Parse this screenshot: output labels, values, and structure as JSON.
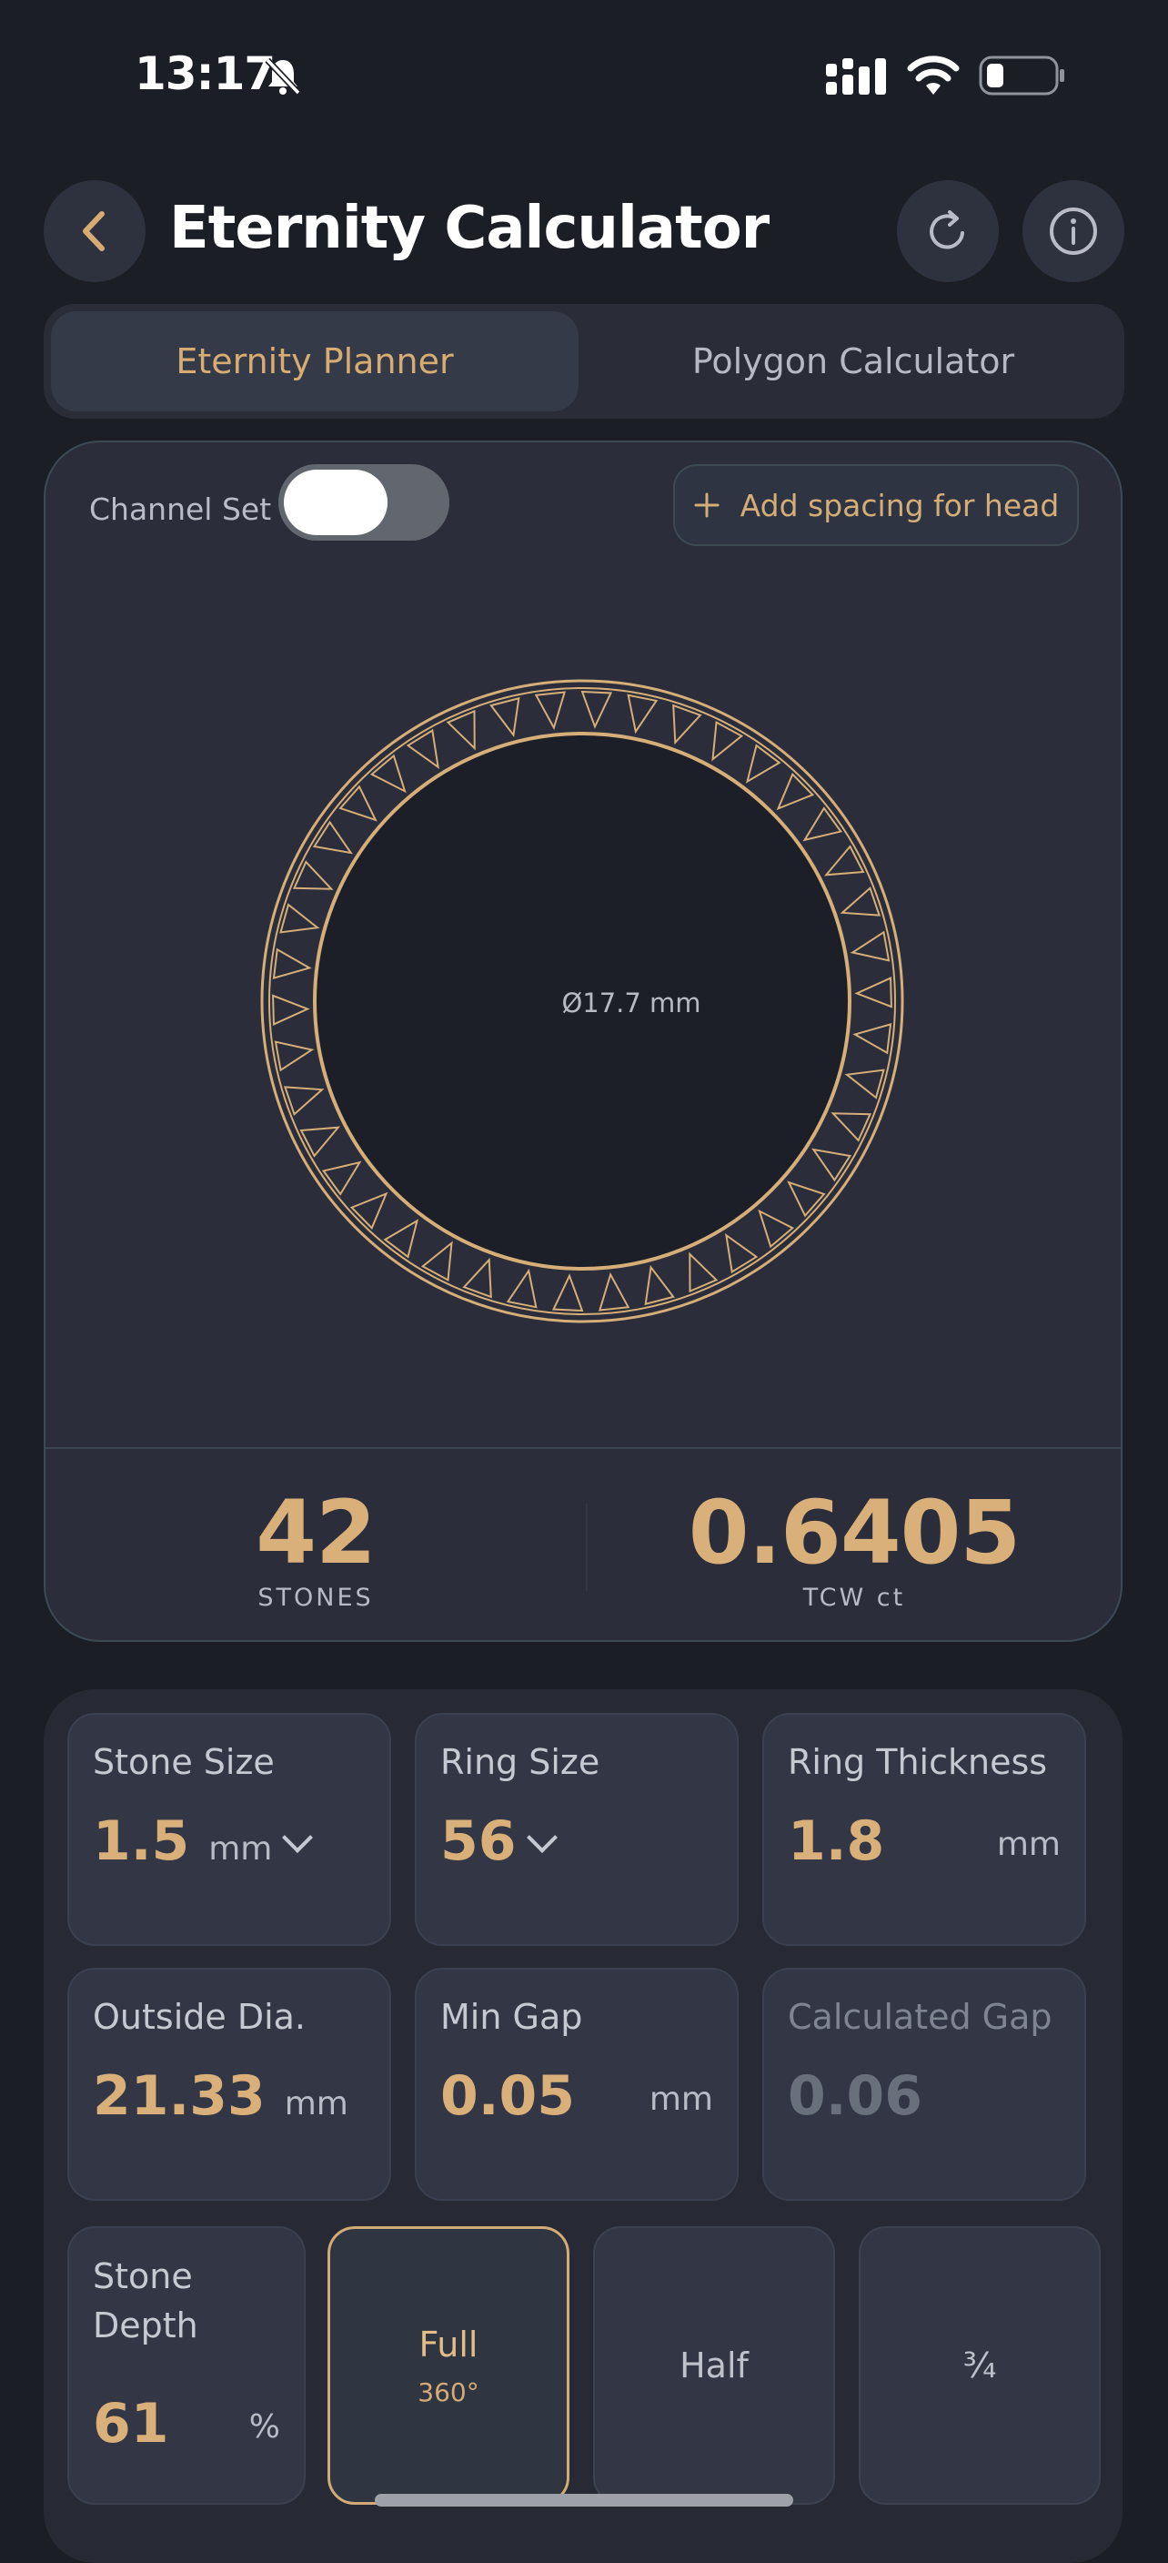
{
  "status_bar": {
    "time": "13:17",
    "icons": [
      "bell-slash-icon",
      "signal-icon",
      "wifi-icon",
      "battery-icon"
    ]
  },
  "header": {
    "title": "Eternity Calculator",
    "back_icon": "chevron-left-icon",
    "reset_icon": "refresh-icon",
    "info_icon": "info-icon"
  },
  "tabs": [
    {
      "label": "Eternity Planner",
      "active": true
    },
    {
      "label": "Polygon Calculator",
      "active": false
    }
  ],
  "visualizer": {
    "channel_set_label": "Channel Set",
    "channel_set_on": false,
    "add_spacing_label": "Add spacing for head",
    "inner_diameter_label": "Ø17.7 mm",
    "stone_count_drawn": 42
  },
  "results": {
    "stones_value": "42",
    "stones_label": "STONES",
    "tcw_value": "0.6405",
    "tcw_label": "TCW ct"
  },
  "inputs": {
    "stone_size": {
      "label": "Stone Size",
      "value": "1.5",
      "unit": "mm"
    },
    "ring_size": {
      "label": "Ring Size",
      "value": "56"
    },
    "ring_thickness": {
      "label": "Ring Thickness",
      "value": "1.8",
      "unit": "mm"
    },
    "outside_dia": {
      "label": "Outside Dia.",
      "value": "21.33",
      "unit": "mm"
    },
    "min_gap": {
      "label": "Min Gap",
      "value": "0.05",
      "unit": "mm"
    },
    "calculated_gap": {
      "label": "Calculated Gap",
      "value": "0.06"
    },
    "stone_depth": {
      "label_line1": "Stone",
      "label_line2": "Depth",
      "value": "61",
      "unit": "%"
    }
  },
  "coverage_options": [
    {
      "label": "Full",
      "sub": "360°",
      "selected": true
    },
    {
      "label": "Half",
      "sub": "",
      "selected": false
    },
    {
      "label": "¾",
      "sub": "",
      "selected": false
    }
  ],
  "colors": {
    "accent_gold": "#d7ac72",
    "background": "#1c1e26",
    "card": "#2b2e3a"
  }
}
